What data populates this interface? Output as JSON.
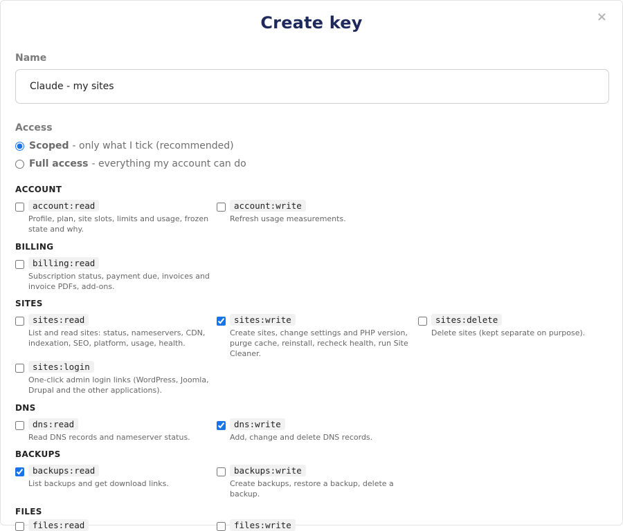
{
  "dialog": {
    "title": "Create key",
    "close_glyph": "×"
  },
  "name_field": {
    "label": "Name",
    "value": "Claude - my sites"
  },
  "access": {
    "label": "Access",
    "options": [
      {
        "bold": "Scoped",
        "rest": "- only what I tick (recommended)",
        "selected": true
      },
      {
        "bold": "Full access",
        "rest": "- everything my account can do",
        "selected": false
      }
    ]
  },
  "sections": {
    "account": {
      "heading": "ACCOUNT",
      "perms": [
        {
          "code": "account:read",
          "desc": "Profile, plan, site slots, limits and usage, frozen state and why.",
          "checked": false
        },
        {
          "code": "account:write",
          "desc": "Refresh usage measurements.",
          "checked": false
        }
      ]
    },
    "billing": {
      "heading": "BILLING",
      "perms": [
        {
          "code": "billing:read",
          "desc": "Subscription status, payment due, invoices and invoice PDFs, add-ons.",
          "checked": false
        }
      ]
    },
    "sites": {
      "heading": "SITES",
      "perms": [
        {
          "code": "sites:read",
          "desc": "List and read sites: status, nameservers, CDN, indexation, SEO, platform, usage, health.",
          "checked": false
        },
        {
          "code": "sites:write",
          "desc": "Create sites, change settings and PHP version, purge cache, reinstall, recheck health, run Site Cleaner.",
          "checked": true
        },
        {
          "code": "sites:delete",
          "desc": "Delete sites (kept separate on purpose).",
          "checked": false
        },
        {
          "code": "sites:login",
          "desc": "One-click admin login links (WordPress, Joomla, Drupal and the other applications).",
          "checked": false
        }
      ]
    },
    "dns": {
      "heading": "DNS",
      "perms": [
        {
          "code": "dns:read",
          "desc": "Read DNS records and nameserver status.",
          "checked": false
        },
        {
          "code": "dns:write",
          "desc": "Add, change and delete DNS records.",
          "checked": true
        }
      ]
    },
    "backups": {
      "heading": "BACKUPS",
      "perms": [
        {
          "code": "backups:read",
          "desc": "List backups and get download links.",
          "checked": true
        },
        {
          "code": "backups:write",
          "desc": "Create backups, restore a backup, delete a backup.",
          "checked": false
        }
      ]
    },
    "files": {
      "heading": "FILES",
      "perms": [
        {
          "code": "files:read",
          "desc": "",
          "checked": false
        },
        {
          "code": "files:write",
          "desc": "",
          "checked": false
        }
      ]
    }
  }
}
